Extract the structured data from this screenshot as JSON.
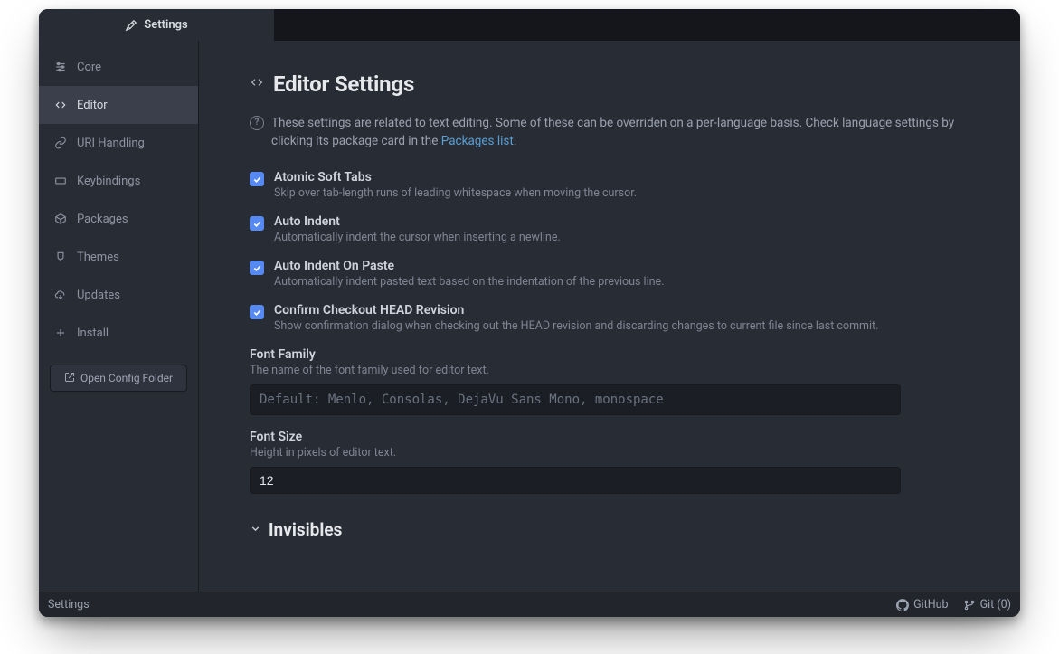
{
  "tab": {
    "title": "Settings"
  },
  "sidebar": {
    "items": [
      {
        "label": "Core"
      },
      {
        "label": "Editor"
      },
      {
        "label": "URI Handling"
      },
      {
        "label": "Keybindings"
      },
      {
        "label": "Packages"
      },
      {
        "label": "Themes"
      },
      {
        "label": "Updates"
      },
      {
        "label": "Install"
      }
    ],
    "active_index": 1,
    "open_config_label": "Open Config Folder"
  },
  "page": {
    "title": "Editor Settings",
    "intro_prefix": "These settings are related to text editing. Some of these can be overriden on a per-language basis. Check language settings by clicking its package card in the ",
    "intro_link": "Packages list",
    "intro_suffix": "."
  },
  "settings": {
    "atomic_soft_tabs": {
      "label": "Atomic Soft Tabs",
      "desc": "Skip over tab-length runs of leading whitespace when moving the cursor.",
      "checked": true
    },
    "auto_indent": {
      "label": "Auto Indent",
      "desc": "Automatically indent the cursor when inserting a newline.",
      "checked": true
    },
    "auto_indent_on_paste": {
      "label": "Auto Indent On Paste",
      "desc": "Automatically indent pasted text based on the indentation of the previous line.",
      "checked": true
    },
    "confirm_checkout_head": {
      "label": "Confirm Checkout HEAD Revision",
      "desc": "Show confirmation dialog when checking out the HEAD revision and discarding changes to current file since last commit.",
      "checked": true
    },
    "font_family": {
      "label": "Font Family",
      "desc": "The name of the font family used for editor text.",
      "placeholder": "Default: Menlo, Consolas, DejaVu Sans Mono, monospace",
      "value": ""
    },
    "font_size": {
      "label": "Font Size",
      "desc": "Height in pixels of editor text.",
      "value": "12"
    }
  },
  "sections": {
    "invisibles": {
      "title": "Invisibles"
    }
  },
  "status": {
    "left": "Settings",
    "github": "GitHub",
    "git_label": "Git (0)"
  },
  "colors": {
    "accent": "#568af2",
    "bg": "#282c34",
    "link": "#5a9fd4"
  }
}
